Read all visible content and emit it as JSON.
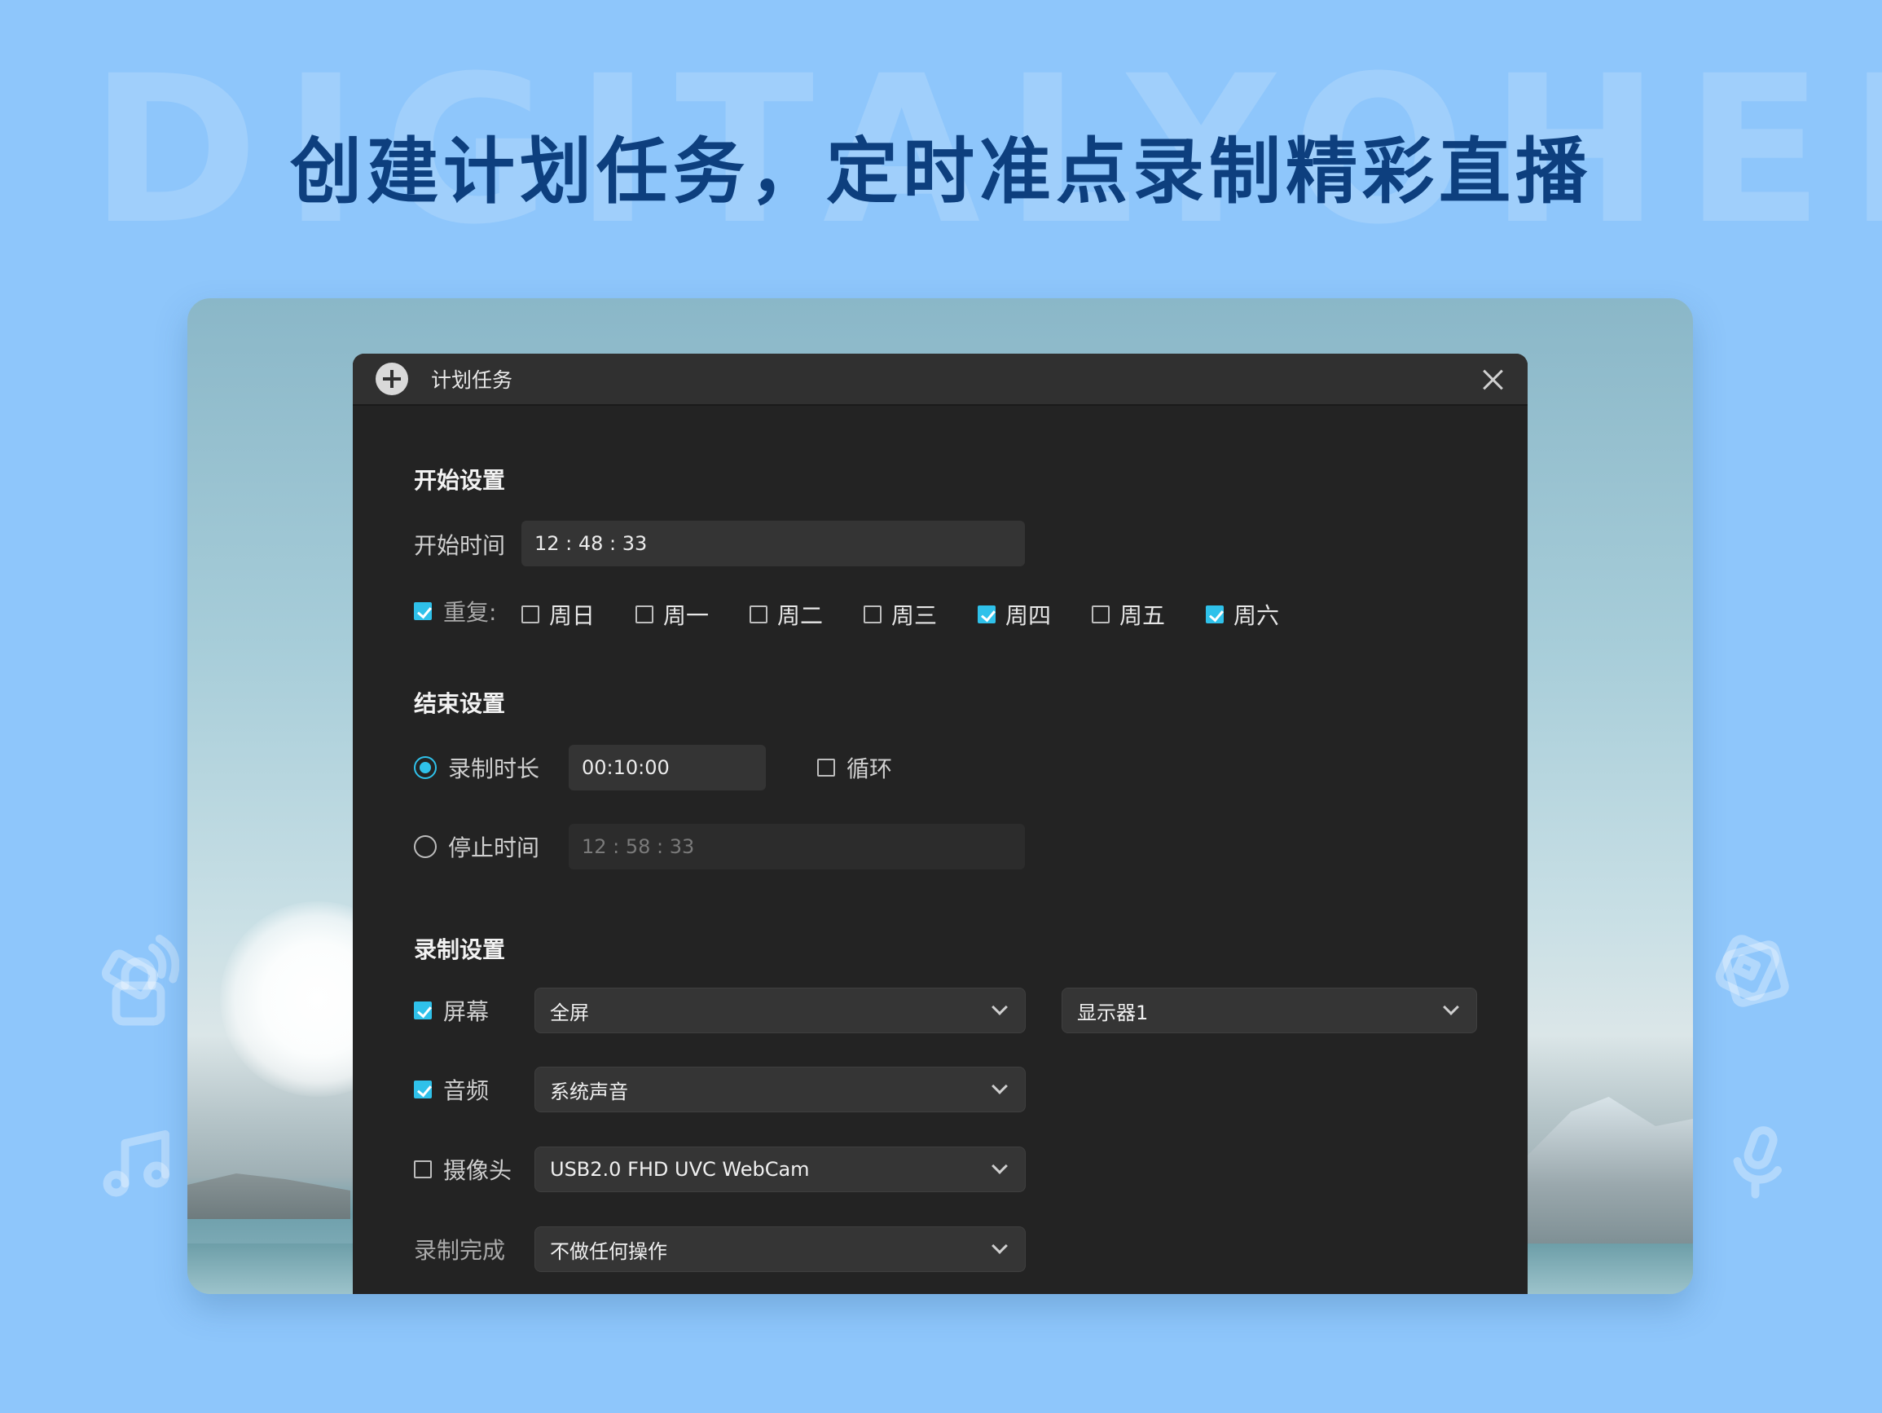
{
  "watermark": "DIGITALYOHEE",
  "headline": "创建计划任务，定时准点录制精彩直播",
  "dialog": {
    "title": "计划任务",
    "start": {
      "section_title": "开始设置",
      "time_label": "开始时间",
      "time_value": "12 : 48 : 33",
      "repeat_label": "重复:",
      "repeat_checked": true,
      "days": [
        {
          "label": "周日",
          "checked": false
        },
        {
          "label": "周一",
          "checked": false
        },
        {
          "label": "周二",
          "checked": false
        },
        {
          "label": "周三",
          "checked": false
        },
        {
          "label": "周四",
          "checked": true
        },
        {
          "label": "周五",
          "checked": false
        },
        {
          "label": "周六",
          "checked": true
        }
      ]
    },
    "end": {
      "section_title": "结束设置",
      "duration_label": "录制时长",
      "duration_value": "00:10:00",
      "duration_selected": true,
      "loop_label": "循环",
      "loop_checked": false,
      "stop_label": "停止时间",
      "stop_value": "12 : 58 : 33",
      "stop_selected": false
    },
    "record": {
      "section_title": "录制设置",
      "screen_label": "屏幕",
      "screen_checked": true,
      "screen_mode": "全屏",
      "display": "显示器1",
      "audio_label": "音频",
      "audio_checked": true,
      "audio_source": "系统声音",
      "camera_label": "摄像头",
      "camera_checked": false,
      "camera_device": "USB2.0 FHD UVC WebCam",
      "finish_label": "录制完成",
      "finish_action": "不做任何操作"
    }
  },
  "colors": {
    "background": "#8ec6fb",
    "headline": "#0d3f7e",
    "dialog": "#232323",
    "accent": "#2fc1ea"
  }
}
